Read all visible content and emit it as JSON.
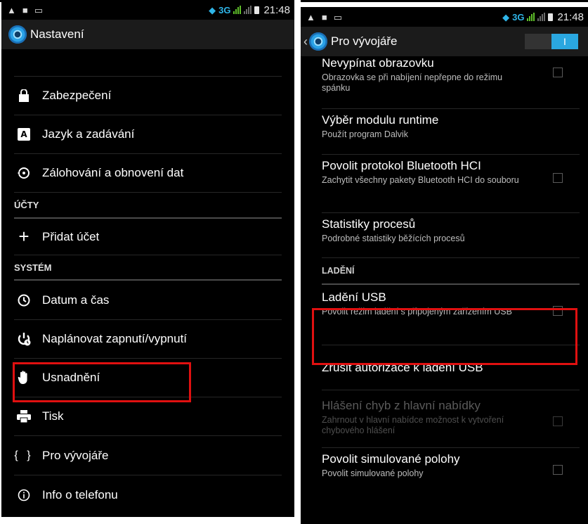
{
  "status_bar": {
    "network": "3G",
    "time_left": "21:48",
    "time_right": "21:48"
  },
  "left": {
    "title": "Nastavení",
    "items": [
      {
        "icon": "lock-icon",
        "label": "Zabezpečení"
      },
      {
        "icon": "keyboard-a-icon",
        "label": "Jazyk a zadávání"
      },
      {
        "icon": "backup-restore-icon",
        "label": "Zálohování a obnovení dat"
      }
    ],
    "section_accounts": "ÚČTY",
    "add_account": "Přidat účet",
    "section_system": "SYSTÉM",
    "system_items": [
      {
        "icon": "clock-icon",
        "label": "Datum a čas"
      },
      {
        "icon": "power-schedule-icon",
        "label": "Naplánovat zapnutí/vypnutí"
      },
      {
        "icon": "hand-icon",
        "label": "Usnadnění"
      },
      {
        "icon": "printer-icon",
        "label": "Tisk"
      },
      {
        "icon": "braces-icon",
        "label": "Pro vývojáře"
      },
      {
        "icon": "info-icon",
        "label": "Info o telefonu"
      }
    ],
    "highlighted_item": "Usnadnění"
  },
  "right": {
    "title": "Pro vývojáře",
    "master_toggle": "on",
    "items": [
      {
        "title": "Nevypínat obrazovku",
        "summary": "Obrazovka se při nabíjení nepřepne do režimu spánku",
        "checkbox": true
      },
      {
        "title": "Výběr modulu runtime",
        "summary": "Použít program Dalvik",
        "checkbox": false
      },
      {
        "title": "Povolit protokol Bluetooth HCI",
        "summary": "Zachytit všechny pakety Bluetooth HCI do souboru",
        "checkbox": true
      },
      {
        "title": "Statistiky procesů",
        "summary": "Podrobné statistiky běžících procesů",
        "checkbox": false
      }
    ],
    "section_debug": "LADĚNÍ",
    "debug_items": [
      {
        "title": "Ladění USB",
        "summary": "Povolit režim ladění s připojeným zařízením USB",
        "checkbox": true
      },
      {
        "title": "Zrušit autorizace k ladění USB",
        "summary": "",
        "checkbox": false
      },
      {
        "title": "Hlášení chyb z hlavní nabídky",
        "summary": "Zahrnout v hlavní nabídce možnost k vytvoření chybového hlášení",
        "checkbox": true,
        "disabled": true
      },
      {
        "title": "Povolit simulované polohy",
        "summary": "Povolit simulované polohy",
        "checkbox": true
      }
    ],
    "highlighted_item": "Ladění USB"
  },
  "colors": {
    "background": "#000000",
    "actionbar": "#1b1b1b",
    "accent": "#2aa7e0",
    "highlight": "#e01010"
  }
}
